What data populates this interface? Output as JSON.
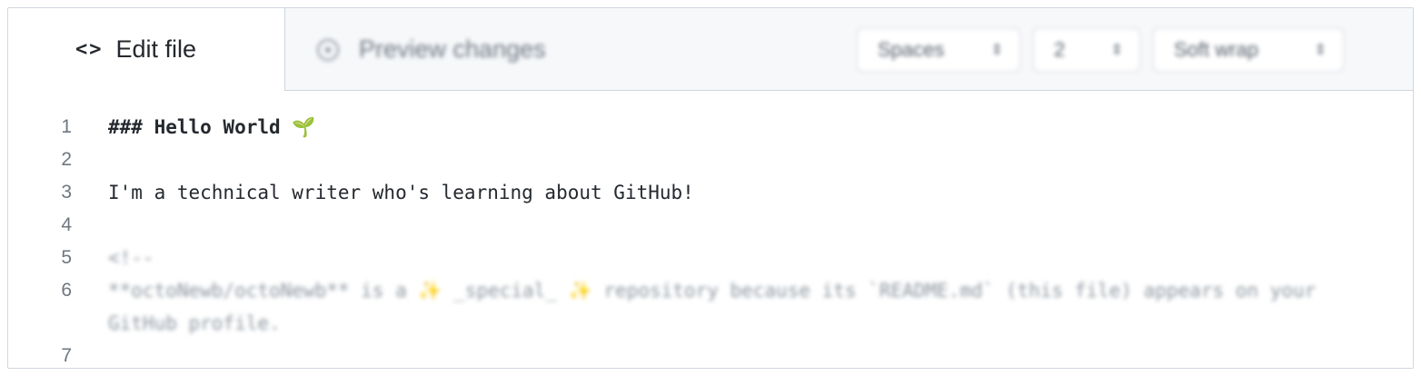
{
  "tabs": {
    "edit": {
      "icon": "code-icon",
      "label": "Edit file"
    },
    "preview": {
      "icon": "eye-icon",
      "label": "Preview changes"
    }
  },
  "controls": {
    "indent_mode": "Spaces",
    "indent_size": "2",
    "wrap_mode": "Soft wrap",
    "arrows": "⇕"
  },
  "editor": {
    "lines": [
      {
        "number": "1",
        "text": "### Hello World ",
        "emoji": "🌱"
      },
      {
        "number": "2",
        "text": ""
      },
      {
        "number": "3",
        "text": "I'm a technical writer who's learning about GitHub!"
      },
      {
        "number": "4",
        "text": ""
      },
      {
        "number": "5",
        "text": "<!--"
      },
      {
        "number": "6",
        "text_a": "**octoNewb/octoNewb** is a ",
        "sparkle": "✨",
        "text_b": " _special_ ",
        "text_c": " repository because its `README.md` (this file) appears on your",
        "wrap": "GitHub profile."
      },
      {
        "number": "7",
        "text": ""
      }
    ]
  },
  "colors": {
    "border": "#d0d7de",
    "header_bg": "#f6f8fa",
    "text": "#24292f",
    "line_number": "#6e7781"
  }
}
